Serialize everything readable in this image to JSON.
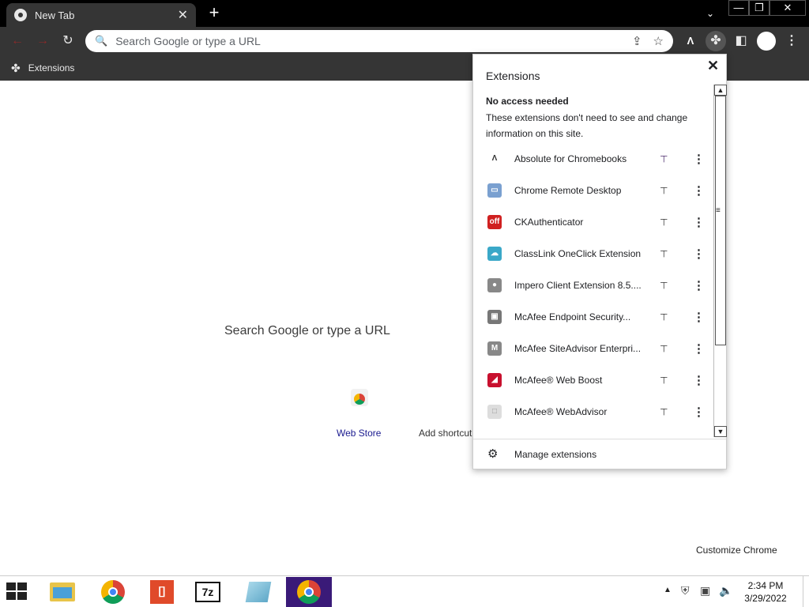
{
  "tab": {
    "title": "New Tab",
    "close": "✕"
  },
  "tabbar": {
    "new_tab": "+",
    "tab_search": "⌄"
  },
  "window": {
    "minimize": "—",
    "maximize": "❐",
    "close": "✕"
  },
  "toolbar": {
    "back": "←",
    "forward": "→",
    "reload": "↻",
    "omnibox_placeholder": "Search Google or type a URL",
    "absolute_icon": "Λ",
    "menu": "⋮"
  },
  "bookmarks": {
    "items": [
      {
        "label": "Extensions"
      }
    ]
  },
  "ntp": {
    "search_label": "Search Google or type a URL",
    "shortcuts": [
      {
        "label": "Web Store"
      },
      {
        "label": "Add shortcut"
      }
    ],
    "customize_label": "Customize Chrome"
  },
  "extensions_popup": {
    "title": "Extensions",
    "section_title": "No access needed",
    "section_desc": "These extensions don't need to see and change information on this site.",
    "items": [
      {
        "name": "Absolute for Chromebooks",
        "pinned": true,
        "icon": "absolute-icon",
        "color": "#333333"
      },
      {
        "name": "Chrome Remote Desktop",
        "pinned": false,
        "icon": "remote-desktop-icon",
        "color": "#7aa0d0"
      },
      {
        "name": "CKAuthenticator",
        "pinned": false,
        "icon": "ckauthenticator-icon",
        "color": "#d02020"
      },
      {
        "name": "ClassLink OneClick Extension",
        "pinned": false,
        "icon": "classlink-icon",
        "color": "#3aa8c8"
      },
      {
        "name": "Impero Client Extension 8.5....",
        "pinned": false,
        "icon": "impero-icon",
        "color": "#888888"
      },
      {
        "name": "McAfee Endpoint Security...",
        "pinned": false,
        "icon": "mcafee-endpoint-icon",
        "color": "#777777"
      },
      {
        "name": "McAfee SiteAdvisor Enterpri...",
        "pinned": false,
        "icon": "mcafee-siteadvisor-icon",
        "color": "#888888"
      },
      {
        "name": "McAfee® Web Boost",
        "pinned": false,
        "icon": "mcafee-webboost-icon",
        "color": "#c8102e"
      },
      {
        "name": "McAfee® WebAdvisor",
        "pinned": false,
        "icon": "mcafee-webadvisor-icon",
        "color": "#dddddd"
      }
    ],
    "manage_label": "Manage extensions"
  },
  "taskbar": {
    "time": "2:34 PM",
    "date": "3/29/2022",
    "apps": [
      "file-explorer",
      "chrome",
      "pdf-reader",
      "7zip",
      "notepad",
      "chrome-active"
    ]
  },
  "colors": {
    "toolbar": "#353535",
    "taskbar_active": "#3a1a78",
    "pinned": "#4a2a6a"
  }
}
